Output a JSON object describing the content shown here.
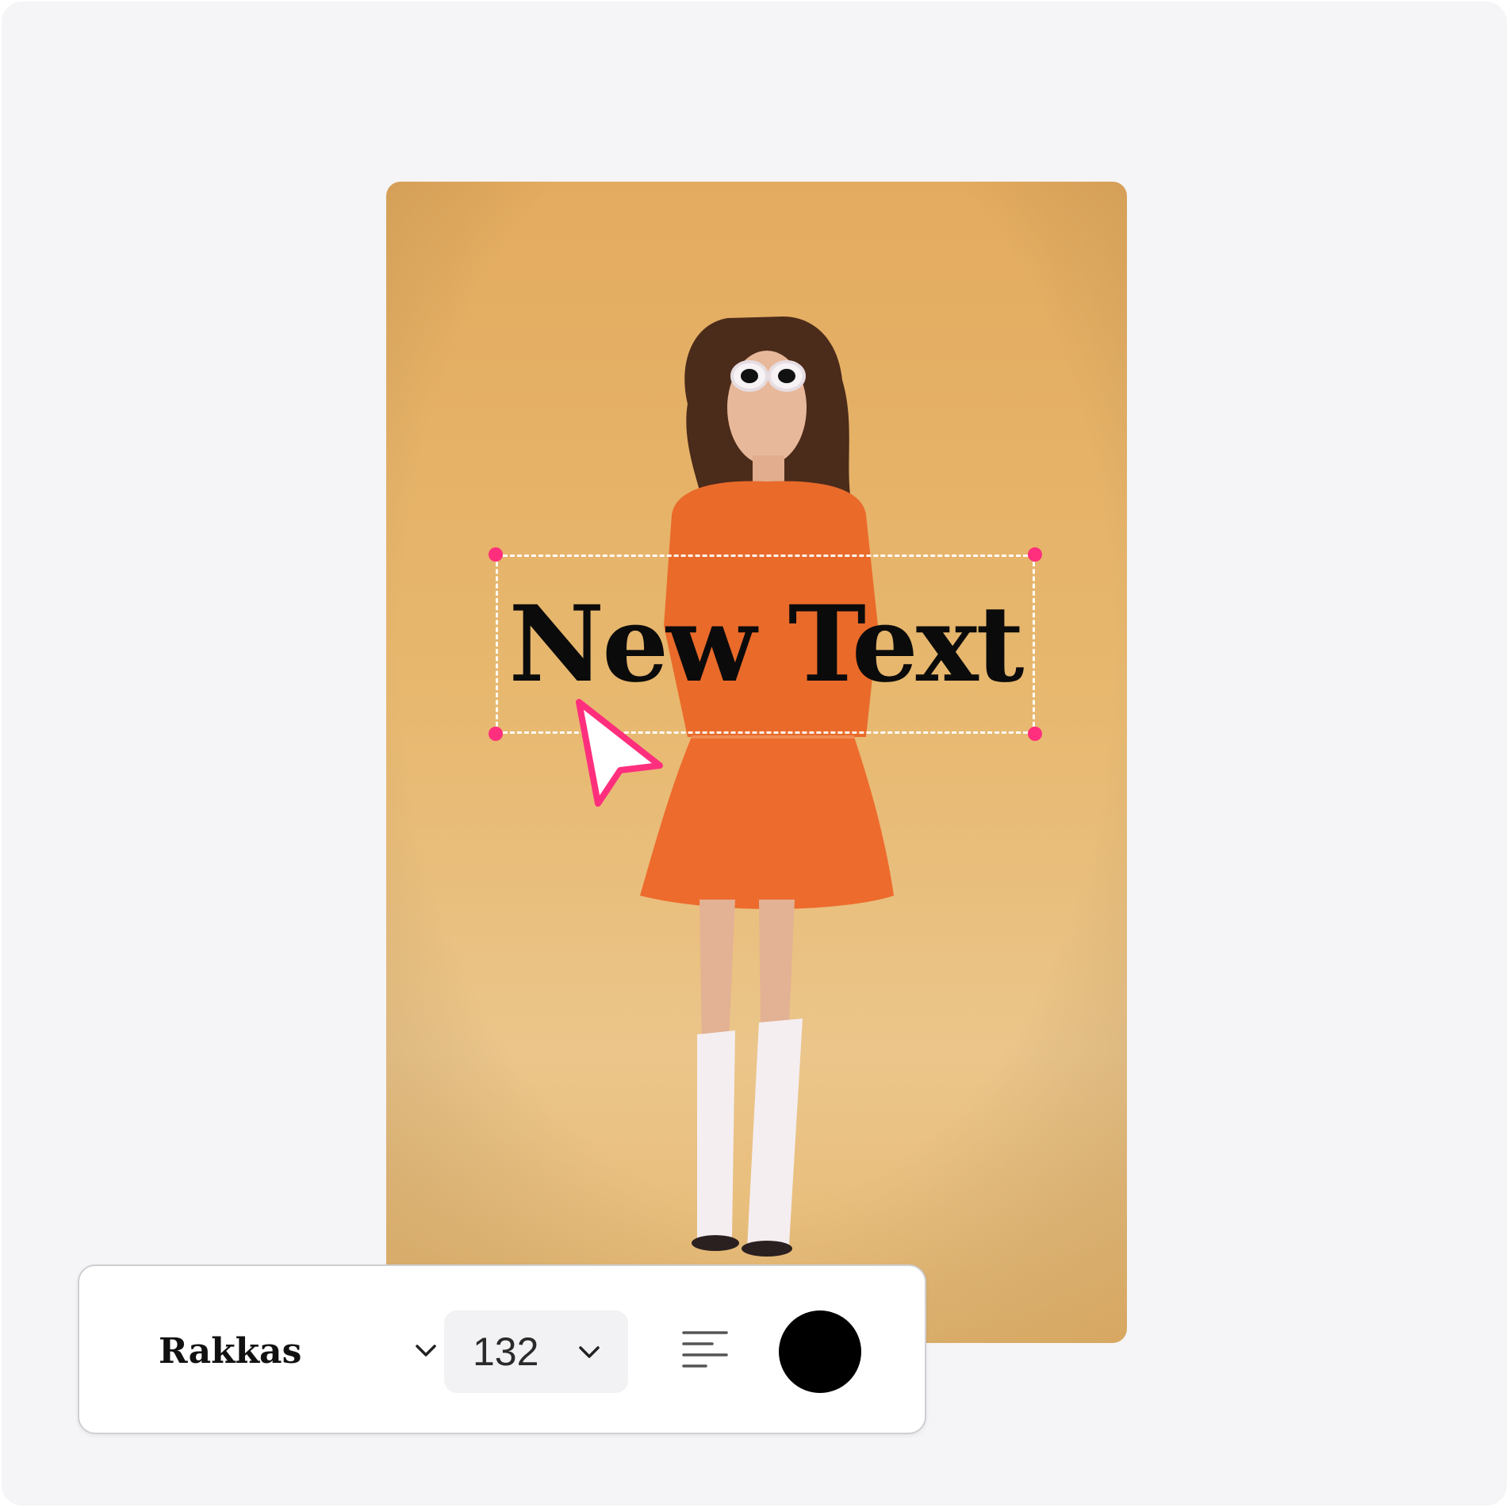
{
  "editor": {
    "canvas_text": "New Text",
    "text_color": "#0b0b0b",
    "handle_color": "#ff2f7d",
    "background_color": "#f5f4f6"
  },
  "toolbar": {
    "font_name": "Rakkas",
    "font_size": "132",
    "align_icon": "align-left-icon",
    "selected_color": "#000000"
  }
}
